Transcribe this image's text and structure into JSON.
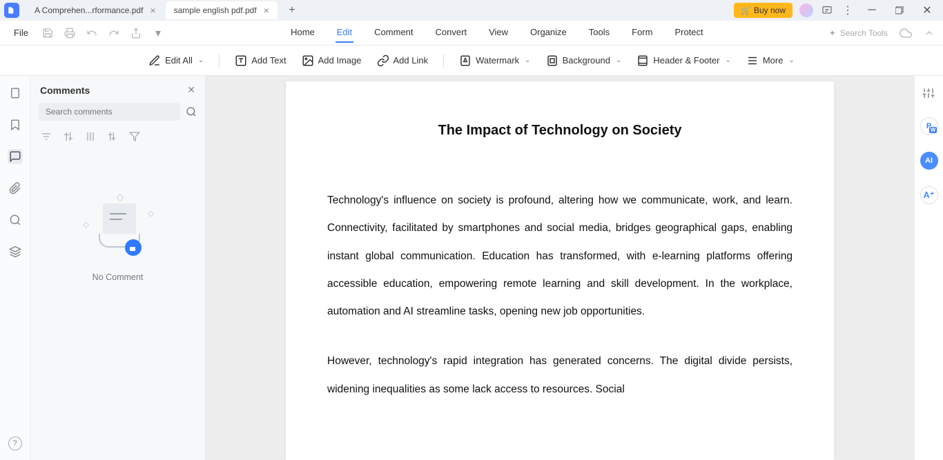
{
  "tabs": {
    "t0": {
      "label": "A Comprehen...rformance.pdf"
    },
    "t1": {
      "label": "sample english pdf.pdf"
    }
  },
  "titlebar": {
    "buy": "Buy now"
  },
  "menu": {
    "file": "File",
    "home": "Home",
    "edit": "Edit",
    "comment": "Comment",
    "convert": "Convert",
    "view": "View",
    "organize": "Organize",
    "tools": "Tools",
    "form": "Form",
    "protect": "Protect",
    "search_tools": "Search Tools"
  },
  "toolbar": {
    "edit_all": "Edit All",
    "add_text": "Add Text",
    "add_image": "Add Image",
    "add_link": "Add Link",
    "watermark": "Watermark",
    "background": "Background",
    "header_footer": "Header & Footer",
    "more": "More"
  },
  "comments_panel": {
    "title": "Comments",
    "search_placeholder": "Search comments",
    "empty": "No Comment"
  },
  "document": {
    "title": "The Impact of Technology on Society",
    "p1": "Technology's influence on society is profound, altering how we communicate, work, and learn. Connectivity, facilitated by smartphones and social media, bridges geographical gaps, enabling instant global communication. Education has transformed, with e-learning platforms offering accessible education, empowering remote learning and skill development. In the workplace, automation and AI streamline tasks, opening new job opportunities.",
    "p2": "However, technology's rapid integration has generated concerns. The digital divide persists, widening inequalities as some lack access to resources. Social"
  }
}
